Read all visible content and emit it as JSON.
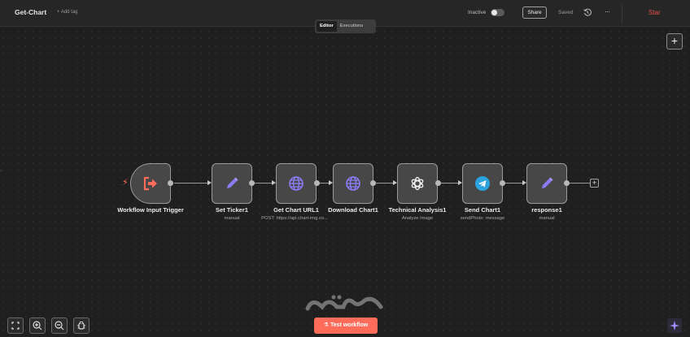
{
  "header": {
    "workflow_name": "Get-Chart",
    "add_tag": "+ Add tag",
    "status_label": "Inactive",
    "share_label": "Share",
    "saved_label": "Saved",
    "more": "···",
    "star_label": "Star"
  },
  "tabs": [
    {
      "label": "Editor",
      "active": true
    },
    {
      "label": "Executions",
      "active": false
    }
  ],
  "nodes": [
    {
      "label": "Workflow Input Trigger",
      "sub": "",
      "icon": "sign-in-icon"
    },
    {
      "label": "Set Ticker1",
      "sub": "manual",
      "icon": "pencil-icon"
    },
    {
      "label": "Get Chart URL1",
      "sub": "POST: https://api.chart-img.co...",
      "icon": "globe-icon"
    },
    {
      "label": "Download Chart1",
      "sub": "",
      "icon": "globe-icon"
    },
    {
      "label": "Technical Analysis1",
      "sub": "Analyze Image",
      "icon": "openai-icon"
    },
    {
      "label": "Send Chart1",
      "sub": "sendPhoto: message",
      "icon": "telegram-icon"
    },
    {
      "label": "response1",
      "sub": "manual",
      "icon": "pencil-icon"
    }
  ],
  "bottom": {
    "test_workflow": "Test workflow"
  },
  "colors": {
    "accent": "#ff6d5a",
    "node_bg": "#474747",
    "canvas_bg": "#1f1f1f"
  }
}
